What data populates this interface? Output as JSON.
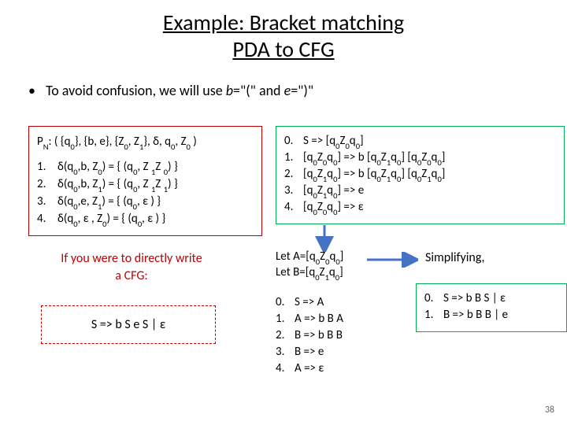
{
  "title_line1": "Example: Bracket matching",
  "title_line2": "PDA to CFG",
  "bullet": "To avoid confusion, we will use ",
  "bullet_b": "b",
  "bullet_mid": "=\"(\" and  ",
  "bullet_e": "e",
  "bullet_end": "=\")\"",
  "pda_header": "P<sub>N</sub>:  ( {q<sub>0</sub>}, {b, e}, {Z<sub>0</sub>, Z<sub>1</sub>}, δ, q<sub>0</sub>, Z<sub>0</sub> )",
  "pda_rules": [
    {
      "n": "1.",
      "t": "δ(q<sub>0</sub>,b, Z<sub>0</sub>) = { (q<sub>0</sub>, Z <sub>1</sub>Z <sub>0</sub>) }"
    },
    {
      "n": "2.",
      "t": "δ(q<sub>0</sub>,b, Z<sub>1</sub>) = { (q<sub>0</sub>, Z <sub>1</sub>Z <sub>1</sub>) }"
    },
    {
      "n": "3.",
      "t": "δ(q<sub>0</sub>,e, Z<sub>1</sub>) = { (q<sub>0</sub>,  ε ) }"
    },
    {
      "n": "4.",
      "t": "δ(q<sub>0</sub>, ε , Z<sub>0</sub>) = { (q<sub>0</sub>,  ε ) }"
    }
  ],
  "direct_line1": "If you were to directly write",
  "direct_line2": "a CFG:",
  "direct_grammar": "S => b S e S |  ε",
  "cfg_rules": [
    {
      "n": "0.",
      "t": "S => [q<sub>0</sub>Z<sub>0</sub>q<sub>0</sub>]"
    },
    {
      "n": "1.",
      "t": "[q<sub>0</sub>Z<sub>0</sub>q<sub>0</sub>] => b [q<sub>0</sub>Z<sub>1</sub>q<sub>0</sub>] [q<sub>0</sub>Z<sub>0</sub>q<sub>0</sub>]"
    },
    {
      "n": "2.",
      "t": "[q<sub>0</sub>Z<sub>1</sub>q<sub>0</sub>] => b [q<sub>0</sub>Z<sub>1</sub>q<sub>0</sub>] [q<sub>0</sub>Z<sub>1</sub>q<sub>0</sub>]"
    },
    {
      "n": "3.",
      "t": "[q<sub>0</sub>Z<sub>1</sub>q<sub>0</sub>] => e"
    },
    {
      "n": "4.",
      "t": "[q<sub>0</sub>Z<sub>0</sub>q<sub>0</sub>] =>  ε"
    }
  ],
  "let_a": "Let A=[q<sub>0</sub>Z<sub>0</sub>q<sub>0</sub>]",
  "let_b": "Let B=[q<sub>0</sub>Z<sub>1</sub>q<sub>0</sub>]",
  "mid_rules": [
    {
      "n": "0.",
      "t": "S => A"
    },
    {
      "n": "1.",
      "t": "A => b B A"
    },
    {
      "n": "2.",
      "t": "B => b B B"
    },
    {
      "n": "3.",
      "t": "B => e"
    },
    {
      "n": "4.",
      "t": "A =>  ε"
    }
  ],
  "simp_label": "Simplifying,",
  "simp_rules": [
    {
      "n": "0.",
      "t": "S => b B S |  ε"
    },
    {
      "n": "1.",
      "t": "B => b B B | e"
    }
  ],
  "pagenum": "38"
}
